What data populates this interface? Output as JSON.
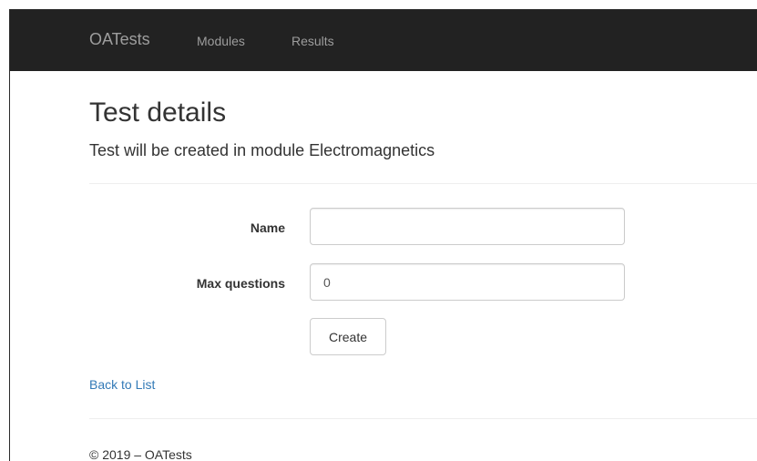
{
  "navbar": {
    "brand": "OATests",
    "links": [
      {
        "label": "Modules"
      },
      {
        "label": "Results"
      }
    ]
  },
  "page": {
    "title": "Test details",
    "subtitle": "Test will be created in module Electromagnetics"
  },
  "form": {
    "name": {
      "label": "Name",
      "value": "",
      "placeholder": ""
    },
    "max_questions": {
      "label": "Max questions",
      "value": "0"
    },
    "create_label": "Create"
  },
  "back_link": "Back to List",
  "footer": {
    "text": "© 2019 – OATests"
  },
  "colors": {
    "navbar_bg": "#222222",
    "nav_text": "#9d9d9d",
    "link": "#337ab7",
    "text": "#333333"
  }
}
